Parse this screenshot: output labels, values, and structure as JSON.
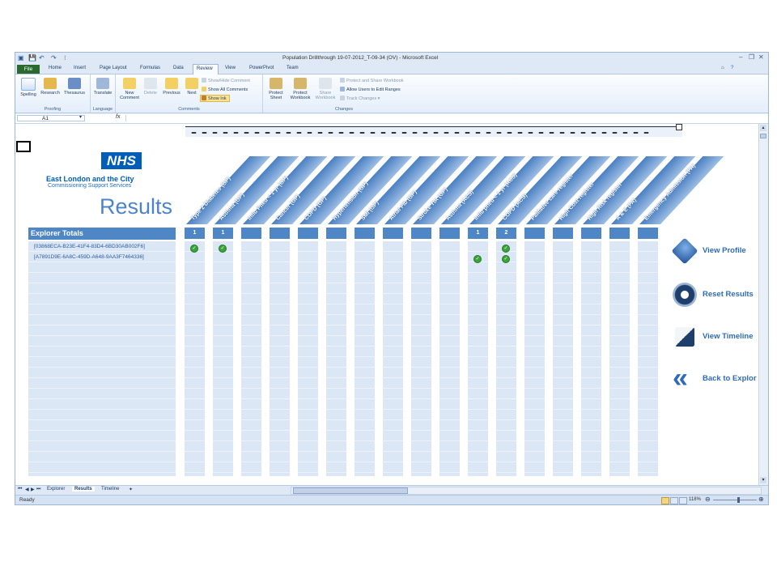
{
  "window": {
    "title": "Population Drillthrough 19-07-2012_T-09-34 (OV) - Microsoft Excel"
  },
  "tabs": [
    "File",
    "Home",
    "Insert",
    "Page Layout",
    "Formulas",
    "Data",
    "Review",
    "View",
    "PowerPivot",
    "Team"
  ],
  "ribbon": {
    "proofing": {
      "label": "Proofing",
      "buttons": [
        "Spelling",
        "Research",
        "Thesaurus"
      ]
    },
    "language": {
      "label": "Language",
      "buttons": [
        "Translate"
      ]
    },
    "comments": {
      "label": "Comments",
      "new": "New Comment",
      "delete": "Delete",
      "previous": "Previous",
      "next": "Next",
      "show_hide": "Show/Hide Comment",
      "show_all": "Show All Comments",
      "show_ink": "Show Ink"
    },
    "changes": {
      "label": "Changes",
      "protect_sheet": "Protect Sheet",
      "protect_workbook": "Protect Workbook",
      "share_workbook": "Share Workbook",
      "protect_share": "Protect and Share Workbook",
      "allow_users": "Allow Users to Edit Ranges",
      "track_changes": "Track Changes"
    }
  },
  "formula_bar": {
    "cell": "A1",
    "fx": "fx"
  },
  "logo": {
    "nhs": "NHS",
    "org_line1": "East London and the City",
    "org_line2": "Commissioning Support Services"
  },
  "results_title": "Results",
  "explorer": {
    "title": "Explorer Totals",
    "items": [
      "[03868ECA-B23E-41F4-83D4-6BD30AB002F6]",
      "[A7891D9E-6A8C-459D-A648-9AA3F7464336]"
    ]
  },
  "columns": [
    {
      "label": "Type 2 Diabetes (GP)",
      "total": "1",
      "checks": [
        true,
        false
      ]
    },
    {
      "label": "Asthma (GP)",
      "total": "1",
      "checks": [
        true,
        false
      ]
    },
    {
      "label": "Influ  Pneu < 1 yr (GP)",
      "total": "",
      "checks": [
        false,
        false
      ]
    },
    {
      "label": "Cancer (GP)",
      "total": "",
      "checks": [
        false,
        false
      ]
    },
    {
      "label": "COPD (GP)",
      "total": "",
      "checks": [
        false,
        false
      ]
    },
    {
      "label": "Hypertension (GP)",
      "total": "",
      "checks": [
        false,
        false
      ]
    },
    {
      "label": "SMI (GP)",
      "total": "",
      "checks": [
        false,
        false
      ]
    },
    {
      "label": "Atrial Fib (GP)",
      "total": "",
      "checks": [
        false,
        false
      ]
    },
    {
      "label": "Stroke TIA (GP)",
      "total": "",
      "checks": [
        false,
        false
      ]
    },
    {
      "label": "Asthma (ACS)",
      "total": "",
      "checks": [
        false,
        false
      ]
    },
    {
      "label": "Influ pneu < 1 yr (ACS)",
      "total": "1",
      "checks": [
        false,
        true
      ]
    },
    {
      "label": "COPD (ACS)",
      "total": "2",
      "checks": [
        true,
        true
      ]
    },
    {
      "label": "Palliative care register",
      "total": "",
      "checks": [
        false,
        false
      ]
    },
    {
      "label": "High Cost register",
      "total": "",
      "checks": [
        false,
        false
      ]
    },
    {
      "label": "High Risk register",
      "total": "",
      "checks": [
        false,
        false
      ]
    },
    {
      "label": "A & E (FA)",
      "total": "",
      "checks": [
        false,
        false
      ]
    },
    {
      "label": "Emergency Admission (FA)",
      "total": "",
      "checks": [
        false,
        false
      ]
    }
  ],
  "side_buttons": [
    "View Profile",
    "Reset Results",
    "View Timeline",
    "Back to Explor"
  ],
  "sheet_tabs": [
    "Explorer",
    "Results",
    "Timeline"
  ],
  "status": {
    "ready": "Ready",
    "zoom": "118%"
  },
  "colors": {
    "accent": "#4f86c6",
    "nhs_blue": "#005eb8",
    "check_green": "#3aa33a",
    "file_tab": "#2a6a2f"
  }
}
